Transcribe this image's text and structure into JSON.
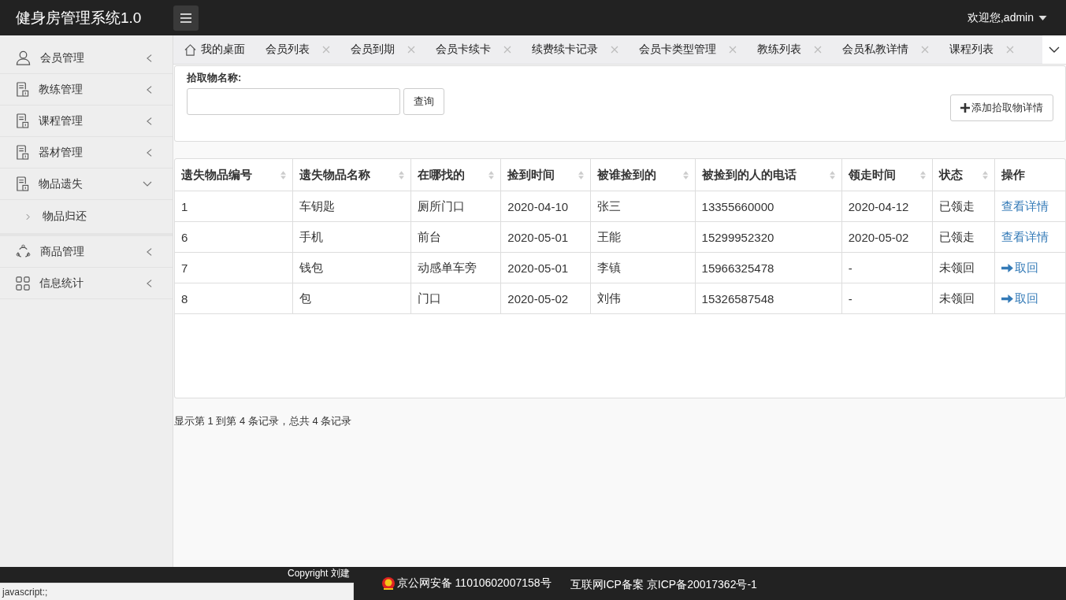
{
  "header": {
    "title": "健身房管理系统1.0",
    "user": "欢迎您,admin"
  },
  "sidebar": {
    "items": [
      {
        "label": "会员管理",
        "kind": "user",
        "expanded": false
      },
      {
        "label": "教练管理",
        "kind": "doc",
        "expanded": false
      },
      {
        "label": "课程管理",
        "kind": "doc",
        "expanded": false
      },
      {
        "label": "器材管理",
        "kind": "doc",
        "expanded": false
      },
      {
        "label": "物品遗失",
        "kind": "doc",
        "expanded": true,
        "children": [
          {
            "label": "物品归还"
          }
        ]
      },
      {
        "label": "商品管理",
        "kind": "cycle",
        "expanded": false
      },
      {
        "label": "信息统计",
        "kind": "grid",
        "expanded": false
      }
    ]
  },
  "tabs": [
    {
      "label": "我的桌面",
      "kind": "home",
      "selected": false
    },
    {
      "label": "会员列表",
      "kind": "closable",
      "selected": false
    },
    {
      "label": "会员到期",
      "kind": "closable",
      "selected": false
    },
    {
      "label": "会员卡续卡",
      "kind": "closable",
      "selected": false
    },
    {
      "label": "续费续卡记录",
      "kind": "closable",
      "selected": false
    },
    {
      "label": "会员卡类型管理",
      "kind": "closable",
      "selected": false
    },
    {
      "label": "教练列表",
      "kind": "closable",
      "selected": false
    },
    {
      "label": "会员私教详情",
      "kind": "closable",
      "selected": false
    },
    {
      "label": "课程列表",
      "kind": "closable",
      "selected": false
    }
  ],
  "search": {
    "label": "拾取物名称:",
    "button": "查询",
    "add_button": "添加拾取物详情"
  },
  "table": {
    "columns": [
      "遗失物品编号",
      "遗失物品名称",
      "在哪找的",
      "捡到时间",
      "被谁捡到的",
      "被捡到的人的电话",
      "领走时间",
      "状态",
      "操作"
    ],
    "rows": [
      {
        "cells": [
          "1",
          "车钥匙",
          "厕所门口",
          "2020-04-10",
          "张三",
          "13355660000",
          "2020-04-12",
          "已领走"
        ],
        "action": {
          "kind": "link",
          "label": "查看详情"
        }
      },
      {
        "cells": [
          "6",
          "手机",
          "前台",
          "2020-05-01",
          "王能",
          "15299952320",
          "2020-05-02",
          "已领走"
        ],
        "action": {
          "kind": "link",
          "label": "查看详情"
        }
      },
      {
        "cells": [
          "7",
          "钱包",
          "动感单车旁",
          "2020-05-01",
          "李镇",
          "15966325478",
          "-",
          "未领回"
        ],
        "action": {
          "kind": "return",
          "label": "取回"
        }
      },
      {
        "cells": [
          "8",
          "包",
          "门口",
          "2020-05-02",
          "刘伟",
          "15326587548",
          "-",
          "未领回"
        ],
        "action": {
          "kind": "return",
          "label": "取回"
        }
      }
    ]
  },
  "pagination": "显示第 1 到第 4 条记录，总共 4 条记录",
  "footer": {
    "copyright": "Copyright 刘建",
    "police": "京公网安备 11010602007158号",
    "icp": "互联网ICP备案 京ICP备20017362号-1"
  },
  "status_bar": "javascript:;"
}
